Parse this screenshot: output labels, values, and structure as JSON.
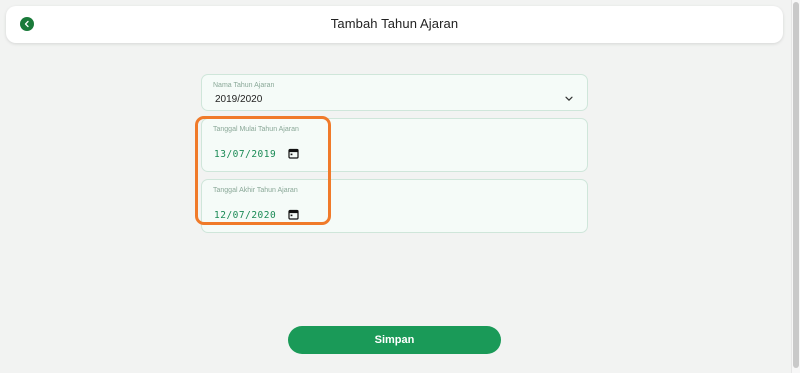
{
  "header": {
    "title": "Tambah Tahun Ajaran",
    "back_icon": "chevron-left-icon"
  },
  "form": {
    "tahun_ajaran": {
      "label": "Nama Tahun Ajaran",
      "value": "2019/2020"
    },
    "tanggal_mulai": {
      "label": "Tanggal Mulai Tahun Ajaran",
      "value": "13/07/2019"
    },
    "tanggal_akhir": {
      "label": "Tanggal Akhir Tahun Ajaran",
      "value": "12/07/2020"
    },
    "save_label": "Simpan"
  },
  "colors": {
    "accent": "#1a9a58",
    "back_button": "#1a7a3a",
    "highlight": "#f07a2a",
    "date_text": "#1a8a55"
  }
}
